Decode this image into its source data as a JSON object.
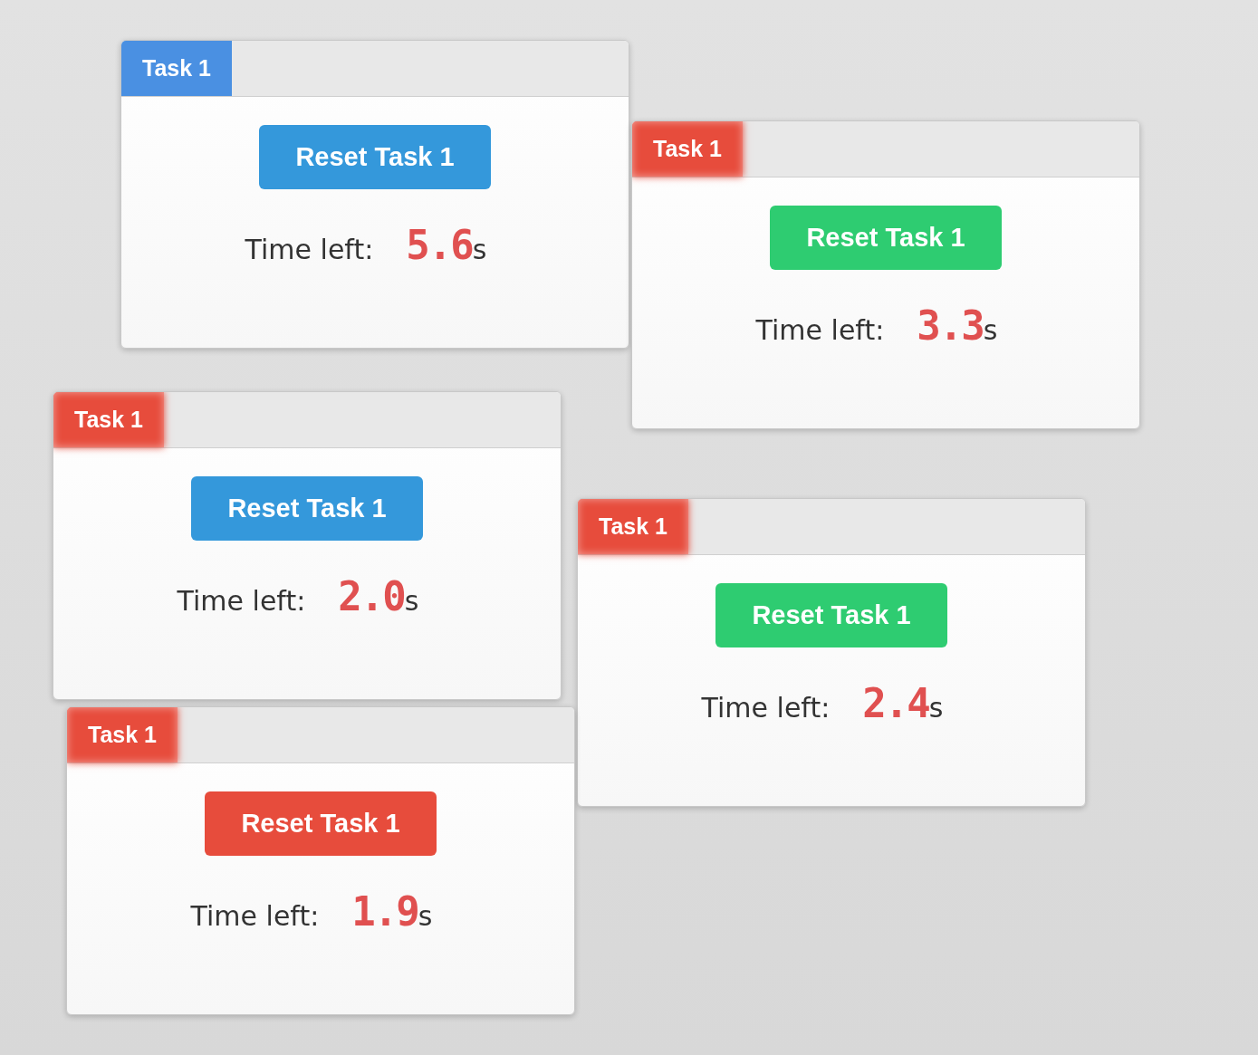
{
  "cards": [
    {
      "tab": {
        "label": "Task 1",
        "color": "#4a90e2"
      },
      "button": {
        "label": "Reset Task 1",
        "color": "#3498db"
      },
      "time_label": "Time left:",
      "time_value": "5.6",
      "time_unit": "s"
    },
    {
      "tab": {
        "label": "Task 1",
        "color": "#e74c3c"
      },
      "button": {
        "label": "Reset Task 1",
        "color": "#2ecc71"
      },
      "time_label": "Time left:",
      "time_value": "3.3",
      "time_unit": "s"
    },
    {
      "tab": {
        "label": "Task 1",
        "color": "#e74c3c"
      },
      "button": {
        "label": "Reset Task 1",
        "color": "#3498db"
      },
      "time_label": "Time left:",
      "time_value": "2.0",
      "time_unit": "s"
    },
    {
      "tab": {
        "label": "Task 1",
        "color": "#e74c3c"
      },
      "button": {
        "label": "Reset Task 1",
        "color": "#2ecc71"
      },
      "time_label": "Time left:",
      "time_value": "2.4",
      "time_unit": "s"
    },
    {
      "tab": {
        "label": "Task 1",
        "color": "#e74c3c"
      },
      "button": {
        "label": "Reset Task 1",
        "color": "#e74c3c"
      },
      "time_label": "Time left:",
      "time_value": "1.9",
      "time_unit": "s"
    }
  ]
}
